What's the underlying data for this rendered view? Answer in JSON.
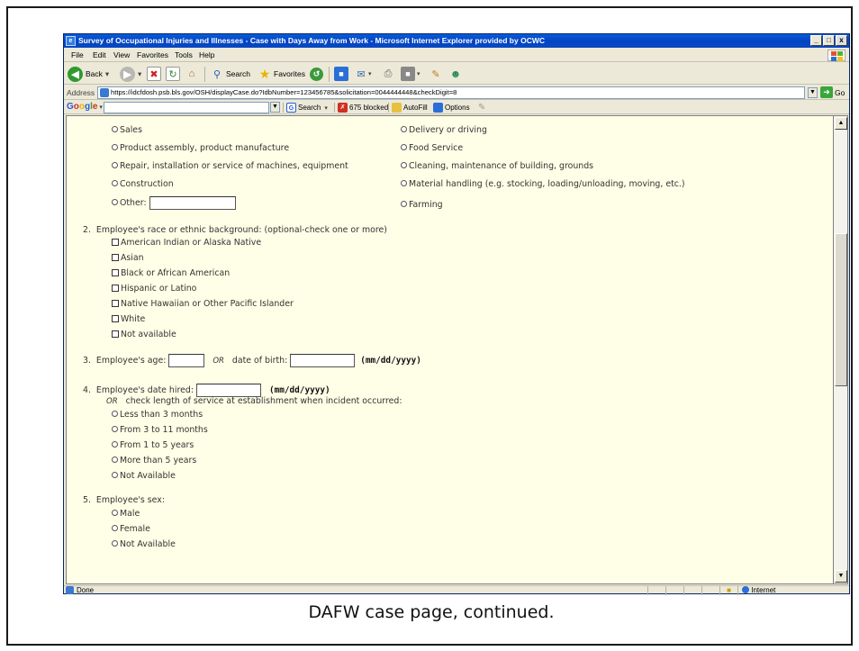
{
  "caption": "DAFW case page, continued.",
  "window": {
    "title": "Survey of Occupational Injuries and Illnesses - Case with Days Away from Work - Microsoft Internet Explorer provided by OCWC",
    "controls": [
      "_",
      "□",
      "x"
    ]
  },
  "menu": [
    "File",
    "Edit",
    "View",
    "Favorites",
    "Tools",
    "Help"
  ],
  "toolbar": {
    "back": "Back",
    "search": "Search",
    "favorites": "Favorites"
  },
  "address": {
    "label": "Address",
    "url": "https://idcfdosh.psb.bls.gov/OSH/displayCase.do?IdbNumber=123456785&solicitation=0044444448&checkDigit=8",
    "go": "Go"
  },
  "google_bar": {
    "logo": "Google",
    "search": "Search",
    "blocked": "675 blocked",
    "autofill": "AutoFill",
    "options": "Options"
  },
  "form": {
    "occupation_left": [
      "Sales",
      "Product assembly, product manufacture",
      "Repair, installation or service of machines, equipment",
      "Construction",
      "Other:"
    ],
    "occupation_right": [
      "Delivery or driving",
      "Food Service",
      "Cleaning, maintenance of building, grounds",
      "Material handling (e.g. stocking, loading/unloading, moving, etc.)",
      "Farming"
    ],
    "q2": {
      "number": "2.",
      "question": "Employee's race or ethnic background: (optional-check one or more)",
      "options": [
        "American Indian or Alaska Native",
        "Asian",
        "Black or African American",
        "Hispanic or Latino",
        "Native Hawaiian or Other Pacific Islander",
        "White",
        "Not available"
      ]
    },
    "q3": {
      "number": "3.",
      "label": "Employee's age:",
      "or": "OR",
      "dob_label": "date of birth:",
      "format": "(mm/dd/yyyy)"
    },
    "q4": {
      "number": "4.",
      "label": "Employee's date hired:",
      "format": "(mm/dd/yyyy)",
      "or": "OR",
      "subtext": "check length of service at establishment when incident occurred:",
      "options": [
        "Less than 3 months",
        "From 3 to 11 months",
        "From 1 to 5 years",
        "More than 5 years",
        "Not Available"
      ]
    },
    "q5": {
      "number": "5.",
      "label": "Employee's sex:",
      "options": [
        "Male",
        "Female",
        "Not Available"
      ]
    }
  },
  "status": {
    "left": "Done",
    "zone": "Internet"
  }
}
